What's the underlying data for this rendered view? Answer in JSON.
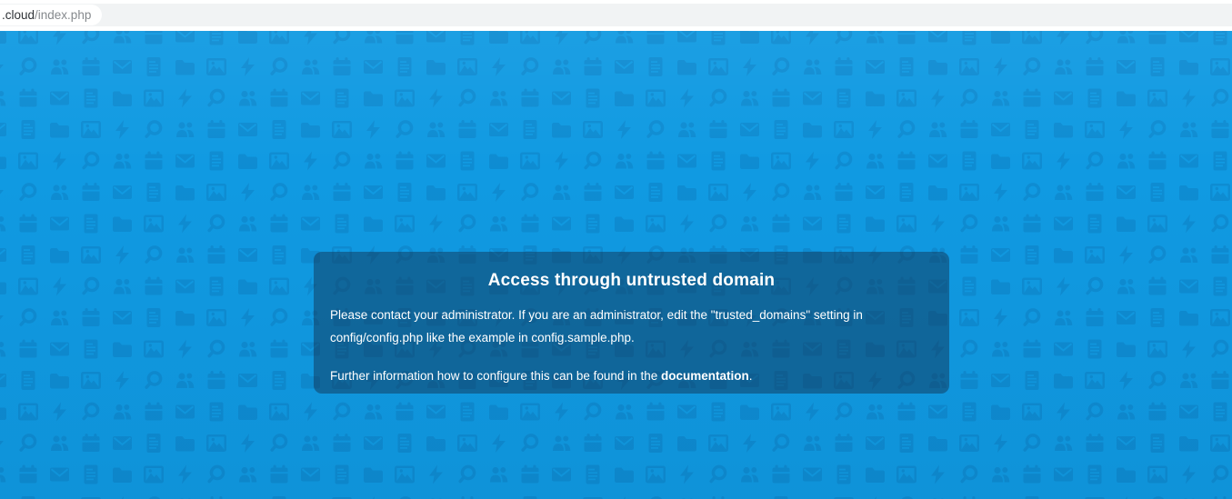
{
  "browser": {
    "url_domain": ".cloud",
    "url_path": "/index.php"
  },
  "error_dialog": {
    "title": "Access through untrusted domain",
    "message": "Please contact your administrator. If you are an administrator, edit the \"trusted_domains\" setting in config/config.php like the example in config.sample.php.",
    "info_prefix": "Further information how to configure this can be found in the ",
    "info_link": "documentation",
    "info_suffix": "."
  },
  "background": {
    "icon_sequence": [
      "image",
      "lightning",
      "search",
      "users",
      "calendar",
      "mail",
      "document",
      "folder"
    ]
  },
  "colors": {
    "background_blue": "#109ae2",
    "pattern_icon_blue": "#0e8cd2",
    "dialog_overlay": "rgba(18,44,74,0.45)",
    "dialog_text": "#ffffff",
    "toolbar_gray": "#f1f3f4"
  }
}
